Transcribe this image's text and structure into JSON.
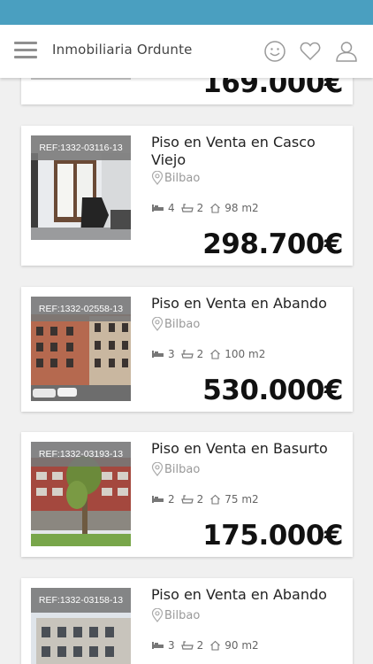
{
  "header": {
    "title": "Inmobiliaria Ordunte",
    "icons": [
      "menu-icon",
      "smiley-icon",
      "heart-icon",
      "user-icon"
    ]
  },
  "listings": [
    {
      "price": "169.000€"
    },
    {
      "ref": "REF:1332-03116-13",
      "title": "Piso en Venta en Casco Viejo",
      "location": "Bilbao",
      "rooms": "4",
      "baths": "2",
      "area": "98 m2",
      "price": "298.700€"
    },
    {
      "ref": "REF:1332-02558-13",
      "title": "Piso en Venta en Abando",
      "location": "Bilbao",
      "rooms": "3",
      "baths": "2",
      "area": "100 m2",
      "price": "530.000€"
    },
    {
      "ref": "REF:1332-03193-13",
      "title": "Piso en Venta en Basurto",
      "location": "Bilbao",
      "rooms": "2",
      "baths": "2",
      "area": "75 m2",
      "price": "175.000€"
    },
    {
      "ref": "REF:1332-03158-13",
      "title": "Piso en Venta en Abando",
      "location": "Bilbao",
      "rooms": "3",
      "baths": "2",
      "area": "90 m2"
    }
  ],
  "colors": {
    "statusbar": "#4a9fc0",
    "ref_badge": "#787878"
  }
}
